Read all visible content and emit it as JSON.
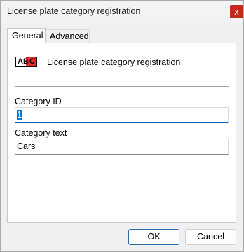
{
  "window": {
    "title": "License plate category registration",
    "close_glyph": "x"
  },
  "tabs": [
    {
      "label": "General",
      "selected": true
    },
    {
      "label": "Advanced",
      "selected": false
    }
  ],
  "header": {
    "icon": "license-plate-icon",
    "icon_text": [
      "A",
      "B",
      "C"
    ],
    "label": "License plate category registration"
  },
  "fields": {
    "category_id": {
      "label": "Category ID",
      "value": "1"
    },
    "category_text": {
      "label": "Category text",
      "value": "Cars"
    }
  },
  "buttons": {
    "ok": "OK",
    "cancel": "Cancel"
  },
  "colors": {
    "accent": "#005fb8",
    "close": "#c42b1c",
    "plate_red": "#ea2a2a"
  }
}
